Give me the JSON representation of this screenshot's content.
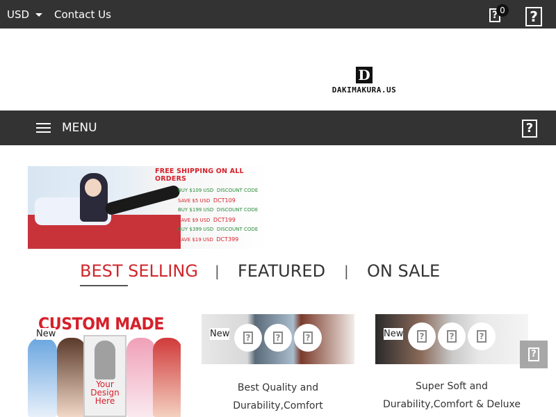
{
  "topbar": {
    "currency": "USD",
    "contact": "Contact Us",
    "cart_icon": "cart-icon",
    "cart_count": "0",
    "user_icon": "user-icon",
    "icon_glyph": "?"
  },
  "header": {
    "logo_letter": "D",
    "logo_text": "DAKIMAKURA.US"
  },
  "nav": {
    "menu_label": "MENU",
    "search_icon": "search-icon",
    "icon_glyph": "?"
  },
  "banner": {
    "headline": "FREE SHIPPING ON ALL ORDERS",
    "offers": [
      {
        "buy": "BUY $109 USD",
        "label": "DISCOUNT CODE",
        "save": "SAVE $5 USD",
        "code": "DCT109"
      },
      {
        "buy": "BUY $199 USD",
        "label": "DISCOUNT CODE",
        "save": "SAVE $9 USD",
        "code": "DCT199"
      },
      {
        "buy": "BUY $399 USD",
        "label": "DISCOUNT CODE",
        "save": "SAVE $19 USD",
        "code": "DCT399"
      }
    ]
  },
  "tabs": [
    {
      "label": "BEST SELLING",
      "active": true
    },
    {
      "label": "FEATURED",
      "active": false
    },
    {
      "label": "ON SALE",
      "active": false
    }
  ],
  "tab_separator": "|",
  "products": [
    {
      "badge": "New",
      "banner_text": "CUSTOM MADE",
      "design_text": "Your Design Here",
      "title_lines": []
    },
    {
      "badge": "New",
      "title_lines": [
        "Best Quality and",
        "Durability,Comfort"
      ]
    },
    {
      "badge": "New",
      "title_lines": [
        "Super Soft and",
        "Durability,Comfort & Deluxe"
      ]
    }
  ],
  "icon_glyph": "?",
  "colors": {
    "bar": "#333333",
    "accent": "#d0262c"
  }
}
